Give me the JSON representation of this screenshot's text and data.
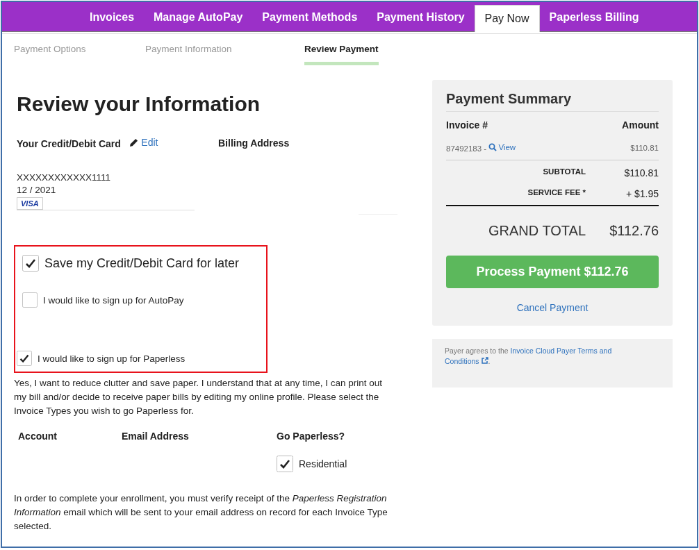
{
  "nav_tabs": [
    {
      "label": "Invoices",
      "selected": false
    },
    {
      "label": "Manage AutoPay",
      "selected": false
    },
    {
      "label": "Payment Methods",
      "selected": false
    },
    {
      "label": "Payment History",
      "selected": false
    },
    {
      "label": "Pay Now",
      "selected": true
    },
    {
      "label": "Paperless Billing",
      "selected": false
    }
  ],
  "steps": [
    {
      "label": "Payment Options",
      "selected": false
    },
    {
      "label": "Payment Information",
      "selected": false
    },
    {
      "label": "Review Payment",
      "selected": true
    }
  ],
  "heading": "Review your Information",
  "card": {
    "label": "Your Credit/Debit Card",
    "edit_link": "Edit",
    "number": "XXXXXXXXXXXX1111",
    "expiry": "12 / 2021",
    "brand": "VISA"
  },
  "billing_address": {
    "label": "Billing Address"
  },
  "options": [
    {
      "kind": "large",
      "label": "Save my Credit/Debit Card for later",
      "checked": true
    },
    {
      "kind": "small",
      "label": "I would like to sign up for AutoPay",
      "checked": false
    },
    {
      "kind": "small",
      "label": "I would like to sign up for Paperless",
      "checked": true
    }
  ],
  "paperless_note": "Yes, I want to reduce clutter and save paper. I understand that at any time, I can print out my bill and/or decide to receive paper bills by editing my online profile. Please select the Invoice Types you wish to go Paperless for.",
  "paperless_table": {
    "columns": [
      "Account",
      "Email Address",
      "Go Paperless?"
    ],
    "options": [
      {
        "label": "Residential",
        "checked": true
      }
    ]
  },
  "enrollment_note": "In order to complete your enrollment, you must verify receipt of the *Paperless Registration Information* email which will be sent to your email address on record for each Invoice Type selected.",
  "summary": {
    "title": "Payment Summary",
    "columns": [
      "Invoice #",
      "Amount"
    ],
    "invoices": [
      {
        "number": "87492183 -",
        "view_link": "View",
        "amount": "$110.81"
      }
    ],
    "subtotal_label": "SUBTOTAL",
    "subtotal": "$110.81",
    "fee_label": "SERVICE FEE *",
    "fee": "+ $1.95",
    "grand_total_label": "GRAND TOTAL",
    "grand_total": "$112.76",
    "process_button": "Process Payment $112.76",
    "cancel_link": "Cancel Payment"
  },
  "terms": {
    "prefix": "Payer agrees to the",
    "link_lines": [
      "Invoice Cloud Payer Terms and",
      "Conditions"
    ],
    "suffix": "."
  }
}
